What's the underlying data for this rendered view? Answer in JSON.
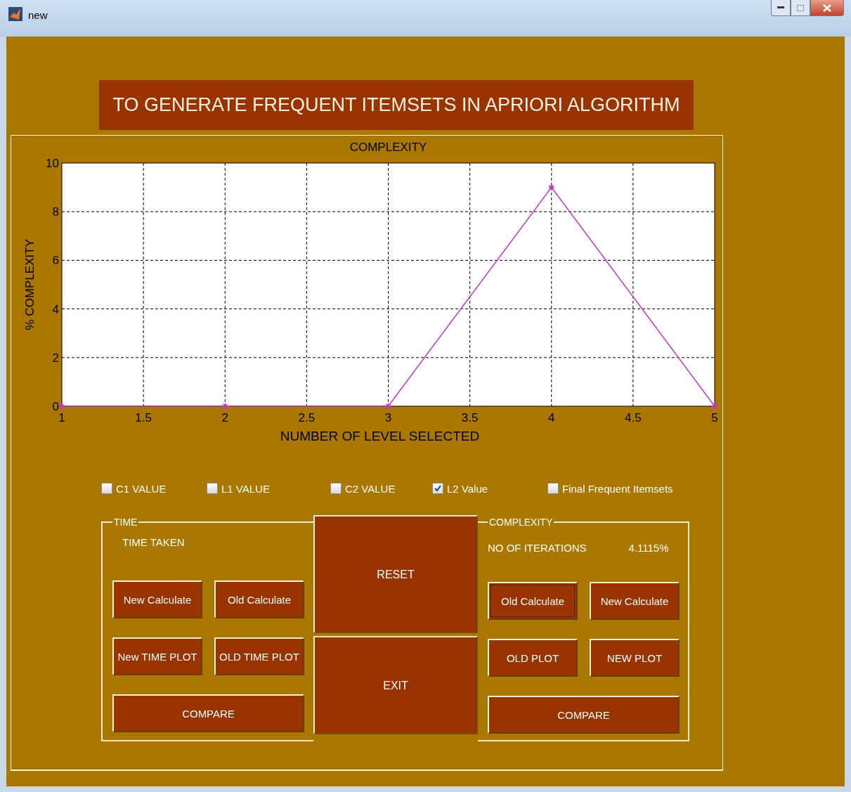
{
  "window": {
    "title": "new"
  },
  "banner": "TO GENERATE FREQUENT ITEMSETS IN APRIORI ALGORITHM",
  "chart": {
    "chart_data": {
      "type": "line",
      "title": "COMPLEXITY",
      "xlabel": "NUMBER OF LEVEL SELECTED",
      "ylabel": "% COMPLEXITY",
      "x": [
        1,
        2,
        3,
        4,
        5
      ],
      "series": [
        {
          "color": "#cc33cc",
          "marker": "cross",
          "values": [
            0,
            0,
            0,
            9,
            0
          ]
        }
      ],
      "grid": true,
      "xlim": [
        1,
        5
      ],
      "ylim": [
        0,
        10
      ],
      "xticks": [
        1,
        1.5,
        2,
        2.5,
        3,
        3.5,
        4,
        4.5,
        5
      ],
      "yticks": [
        0,
        2,
        4,
        6,
        8,
        10
      ]
    }
  },
  "checkboxes": [
    {
      "label": "C1 VALUE",
      "checked": false
    },
    {
      "label": "L1 VALUE",
      "checked": false
    },
    {
      "label": "C2 VALUE",
      "checked": false
    },
    {
      "label": "L2 Value",
      "checked": true
    },
    {
      "label": "Final Frequent Itemsets",
      "checked": false
    }
  ],
  "time_group": {
    "title": "TIME",
    "label": "TIME TAKEN",
    "buttons": [
      {
        "label": "New Calculate",
        "focused": false
      },
      {
        "label": "Old Calculate",
        "focused": false
      },
      {
        "label": "New TIME PLOT",
        "focused": false
      },
      {
        "label": "OLD TIME PLOT",
        "focused": false
      },
      {
        "label": "COMPARE",
        "focused": false
      }
    ]
  },
  "center_buttons": [
    "RESET",
    "EXIT"
  ],
  "complexity_group": {
    "title": "COMPLEXITY",
    "label": "NO OF ITERATIONS",
    "value": "4.1115%",
    "buttons": [
      {
        "label": "Old Calculate",
        "focused": true
      },
      {
        "label": "New Calculate",
        "focused": false
      },
      {
        "label": "OLD  PLOT",
        "focused": false
      },
      {
        "label": "NEW  PLOT",
        "focused": false
      },
      {
        "label": "COMPARE",
        "focused": false
      }
    ]
  }
}
